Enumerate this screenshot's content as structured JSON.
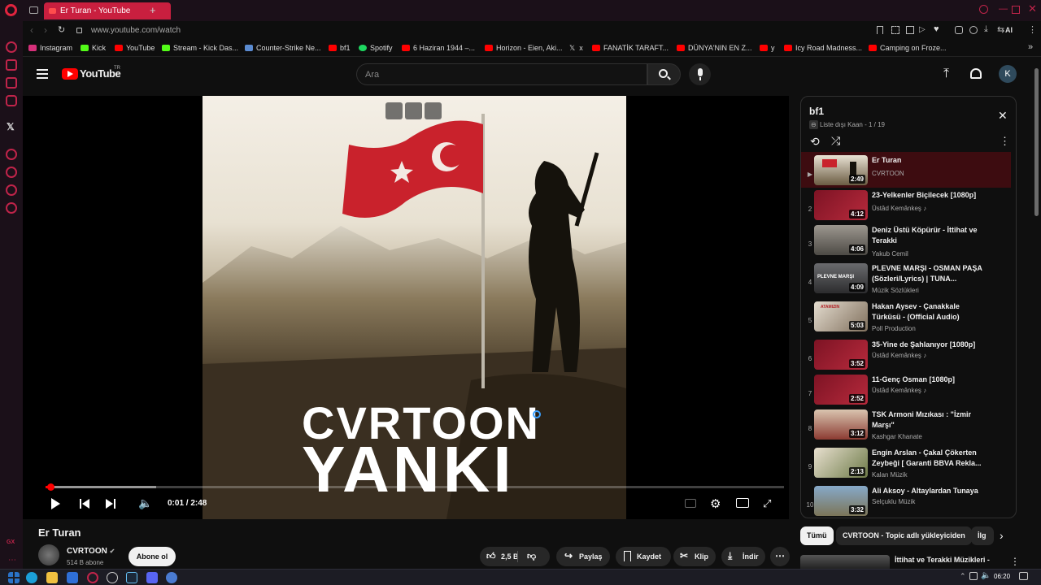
{
  "browser": {
    "active_tab_title": "Er Turan - YouTube",
    "url": "www.youtube.com/watch",
    "ai_label": "AI",
    "bookmarks": [
      {
        "label": "Instagram",
        "color": "#d6307a"
      },
      {
        "label": "Kick",
        "color": "#53fc18"
      },
      {
        "label": "YouTube",
        "color": "#ff0000"
      },
      {
        "label": "Stream - Kick Das...",
        "color": "#53fc18"
      },
      {
        "label": "Counter-Strike Ne...",
        "color": "#5b8bd1"
      },
      {
        "label": "bf1",
        "color": "#ff0000"
      },
      {
        "label": "Spotify",
        "color": "#1ed760"
      },
      {
        "label": "6 Haziran 1944 –...",
        "color": "#ff0000"
      },
      {
        "label": "Horizon - Eien, Aki...",
        "color": "#ff0000"
      },
      {
        "label": "x",
        "color": "#ffffff"
      },
      {
        "label": "FANATİK TARAFT...",
        "color": "#ff0000"
      },
      {
        "label": "DÜNYA'NIN EN Z...",
        "color": "#ff0000"
      },
      {
        "label": "y",
        "color": "#ff0000"
      },
      {
        "label": "Icy Road Madness...",
        "color": "#ff0000"
      },
      {
        "label": "Camping on Froze...",
        "color": "#ff0000"
      }
    ]
  },
  "youtube": {
    "logo_text": "YouTube",
    "region": "TR",
    "search_placeholder": "Ara",
    "avatar_letter": "K"
  },
  "player": {
    "time_current": "0:01",
    "time_total": "2:48",
    "time_display": "0:01 / 2:48",
    "progress_fraction": 0.006,
    "artwork_line1": "CVRTOON",
    "artwork_line2": "YANKI"
  },
  "video": {
    "title": "Er Turan",
    "channel": "CVRTOON",
    "subscribers": "514 B abone",
    "subscribe_label": "Abone ol",
    "likes": "2,5 B",
    "share_label": "Paylaş",
    "save_label": "Kaydet",
    "clip_label": "Klip",
    "download_label": "İndir"
  },
  "playlist": {
    "title": "bf1",
    "meta": "Liste dışı Kaan - 1 / 19",
    "items": [
      {
        "index": "▶",
        "title": "Er Turan",
        "channel": "CVRTOON",
        "duration": "2:49",
        "verified": false
      },
      {
        "index": "2",
        "title": "23-Yelkenler Biçilecek [1080p]",
        "channel": "Üstâd Kemânkeş",
        "duration": "4:12",
        "verified": true
      },
      {
        "index": "3",
        "title": "Deniz Üstü Köpürür - İttihat ve Terakki",
        "channel": "Yakub Cemil",
        "duration": "4:06",
        "verified": false
      },
      {
        "index": "4",
        "title": "PLEVNE MARŞI - OSMAN PAŞA (Sözleri/Lyrics) | TUNA...",
        "channel": "Müzik Sözlükleri",
        "duration": "4:09",
        "verified": false
      },
      {
        "index": "5",
        "title": "Hakan Aysev - Çanakkale Türküsü - (Official Audio)",
        "channel": "Poll Production",
        "duration": "5:03",
        "verified": false
      },
      {
        "index": "6",
        "title": "35-Yine de Şahlanıyor [1080p]",
        "channel": "Üstâd Kemânkeş",
        "duration": "3:52",
        "verified": true
      },
      {
        "index": "7",
        "title": "11-Genç Osman [1080p]",
        "channel": "Üstâd Kemânkeş",
        "duration": "2:52",
        "verified": true
      },
      {
        "index": "8",
        "title": "TSK Armoni Mızıkası : \"İzmir Marşı\"",
        "channel": "Kashgar Khanate",
        "duration": "3:12",
        "verified": false
      },
      {
        "index": "9",
        "title": "Engin Arslan - Çakal Çökerten Zeybeği [ Garanti BBVA Rekla...",
        "channel": "Kalan Müzik",
        "duration": "2:13",
        "verified": false
      },
      {
        "index": "10",
        "title": "Ali Aksoy - Altaylardan Tunaya",
        "channel": "Selçuklu Müzik",
        "duration": "3:32",
        "verified": false
      }
    ],
    "thumb_captions": {
      "plevne": "PLEVNE MARŞI",
      "atamizin": "ATAMIZIN"
    }
  },
  "chips": [
    "Tümü",
    "CVRTOON - Topic adlı yükleyiciden",
    "İlg"
  ],
  "recommendation": {
    "title": "İttihat ve Terakki Müzikleri -"
  },
  "taskbar": {
    "time": "06:20"
  },
  "colors": {
    "accent": "#c91f3f",
    "yt_red": "#ff0000"
  }
}
